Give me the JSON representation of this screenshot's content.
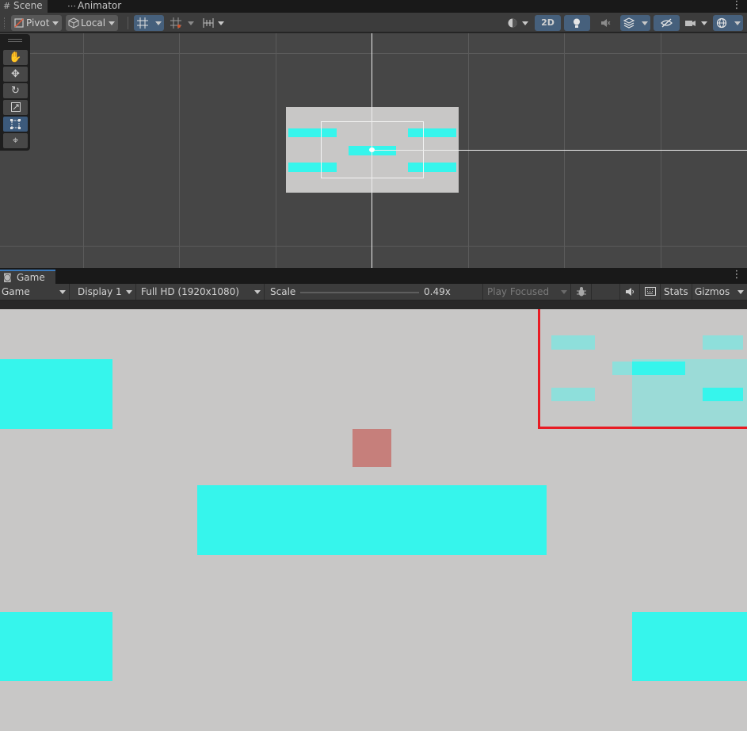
{
  "scene_window": {
    "tabs": [
      {
        "label": "Scene",
        "icon": "grid-icon",
        "active": true
      },
      {
        "label": "Animator",
        "icon": "animator-icon",
        "active": false
      }
    ],
    "toolbar": {
      "pivot_label": "Pivot",
      "local_label": "Local",
      "mode_2d_label": "2D"
    },
    "tool_panel": [
      "hand-tool",
      "move-tool",
      "rotate-tool",
      "scale-tool",
      "rect-tool",
      "transform-tool"
    ],
    "selected_tool": "rect-tool"
  },
  "game_window": {
    "tab_label": "Game",
    "toolbar": {
      "view_mode": "Game",
      "display": "Display 1",
      "resolution": "Full HD (1920x1080)",
      "scale_label": "Scale",
      "scale_value": "0.49x",
      "play_mode": "Play Focused",
      "stats_label": "Stats",
      "gizmos_label": "Gizmos"
    }
  },
  "colors": {
    "platform": "#36f5ec",
    "player": "#c67f7b",
    "background": "#c8c7c6",
    "highlight": "#e81b23"
  }
}
